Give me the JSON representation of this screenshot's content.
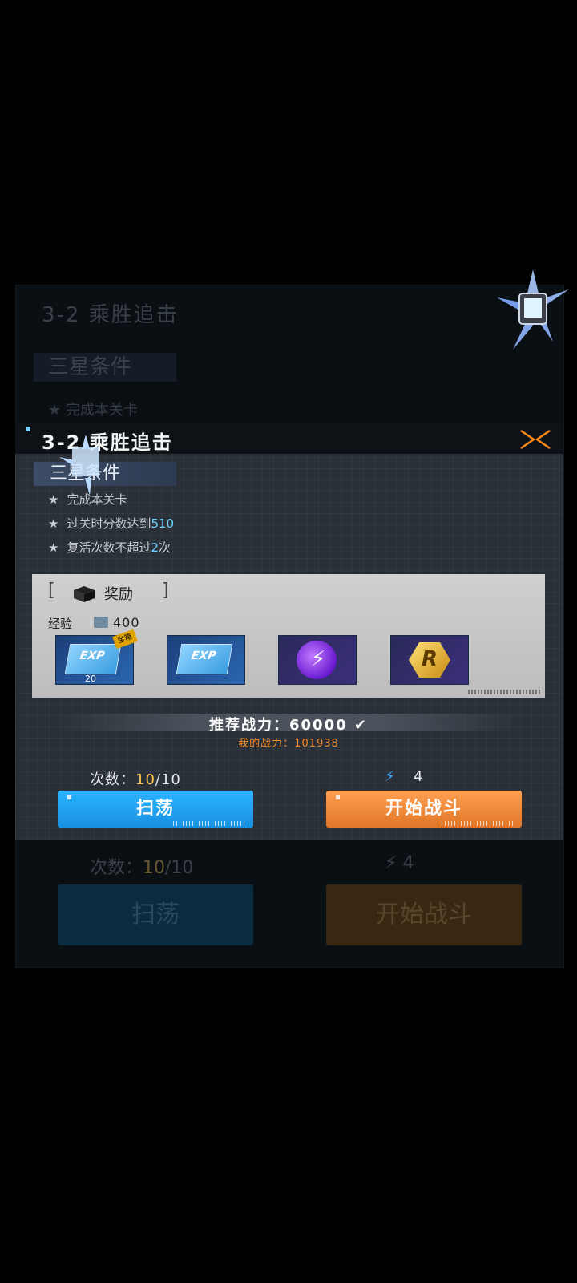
{
  "ghost": {
    "title": "3-2 乘胜追击",
    "section": "三星条件",
    "condition": "完成本关卡",
    "count_label": "次数：",
    "count_cur": "10",
    "count_rest": "/10",
    "energy": "4",
    "sweep": "扫荡",
    "fight": "开始战斗"
  },
  "dialog": {
    "title": "3-2 乘胜追击",
    "section": "三星条件",
    "conditions": [
      {
        "pre": "完成本关卡",
        "hl": "",
        "post": ""
      },
      {
        "pre": "过关时分数达到",
        "hl": "510",
        "post": ""
      },
      {
        "pre": "复活次数不超过",
        "hl": "2",
        "post": "次"
      }
    ],
    "star": "★"
  },
  "reward": {
    "label": "奖励",
    "bracket_left": "[",
    "bracket_right": "]",
    "exp_label": "经验",
    "exp_value": "400",
    "items": [
      {
        "icon": "exp-card-icon",
        "text": "EXP",
        "qty": "20",
        "badge": "宝箱"
      },
      {
        "icon": "exp-card-icon",
        "text": "EXP",
        "qty": "",
        "badge": ""
      },
      {
        "icon": "energy-orb-icon",
        "text": "⚡",
        "qty": "",
        "badge": ""
      },
      {
        "icon": "r-coin-icon",
        "text": "R",
        "qty": "",
        "badge": ""
      }
    ]
  },
  "power": {
    "recommended": "推荐战力：60000 ✔",
    "mine": "我的战力：101938"
  },
  "actions": {
    "count_label": "次数：",
    "count_cur": "10",
    "count_rest": "/10",
    "bolt": "⚡",
    "energy": "4",
    "sweep": "扫荡",
    "fight": "开始战斗"
  },
  "colors": {
    "highlight": "#6fd3ff",
    "count_highlight": "#ffc84a",
    "sweep_button": "#1990e0",
    "fight_button": "#e07628",
    "my_power": "#ff8a1f"
  }
}
